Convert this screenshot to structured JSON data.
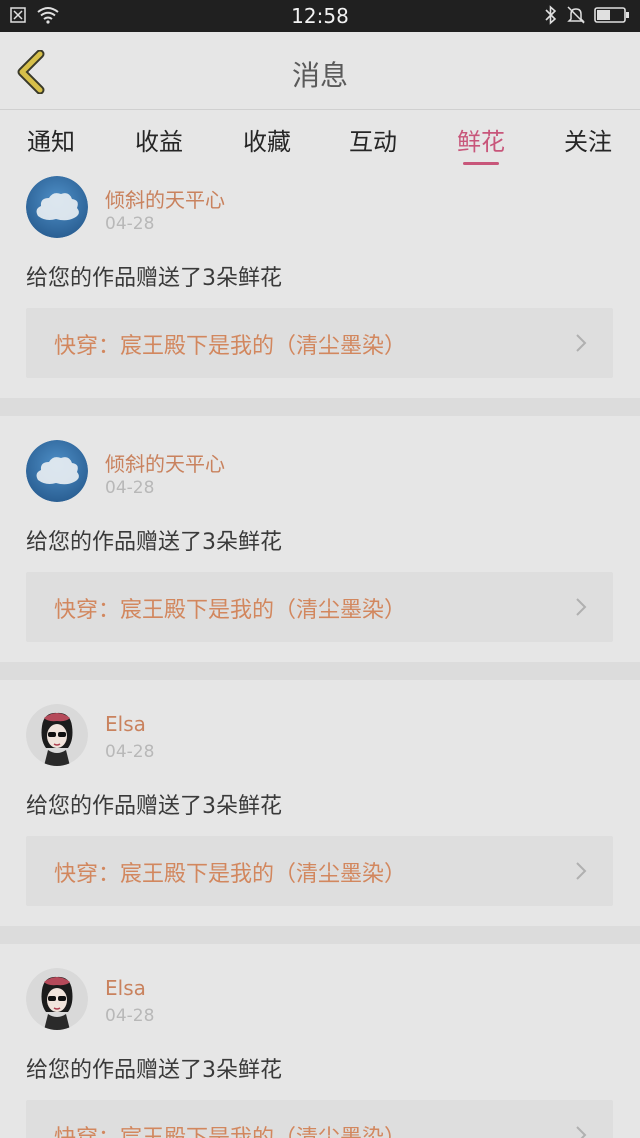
{
  "status_bar": {
    "time": "12:58",
    "icons_left": [
      "notification-x-icon",
      "wifi-icon"
    ],
    "icons_right": [
      "bluetooth-icon",
      "bell-muted-icon",
      "battery-icon"
    ]
  },
  "header": {
    "back_icon": "chevron-left-icon",
    "title": "消息"
  },
  "tabs": [
    {
      "label": "通知",
      "active": false
    },
    {
      "label": "收益",
      "active": false
    },
    {
      "label": "收藏",
      "active": false
    },
    {
      "label": "互动",
      "active": false
    },
    {
      "label": "鲜花",
      "active": true
    },
    {
      "label": "关注",
      "active": false
    }
  ],
  "feed": [
    {
      "avatar": "cloud-avatar",
      "username": "倾斜的天平心",
      "date": "04-28",
      "message": "给您的作品赠送了3朵鲜花",
      "work_title": "快穿：宸王殿下是我的（清尘墨染）"
    },
    {
      "avatar": "cloud-avatar",
      "username": "倾斜的天平心",
      "date": "04-28",
      "message": "给您的作品赠送了3朵鲜花",
      "work_title": "快穿：宸王殿下是我的（清尘墨染）"
    },
    {
      "avatar": "girl-avatar",
      "username": "Elsa",
      "date": "04-28",
      "message": "给您的作品赠送了3朵鲜花",
      "work_title": "快穿：宸王殿下是我的（清尘墨染）"
    },
    {
      "avatar": "girl-avatar",
      "username": "Elsa",
      "date": "04-28",
      "message": "给您的作品赠送了3朵鲜花",
      "work_title": "快穿：宸王殿下是我的（清尘墨染）"
    }
  ],
  "colors": {
    "accent": "#c8567a",
    "username": "#c9825e",
    "work_title": "#d2875e",
    "back_arrow": "#d7c04a"
  }
}
